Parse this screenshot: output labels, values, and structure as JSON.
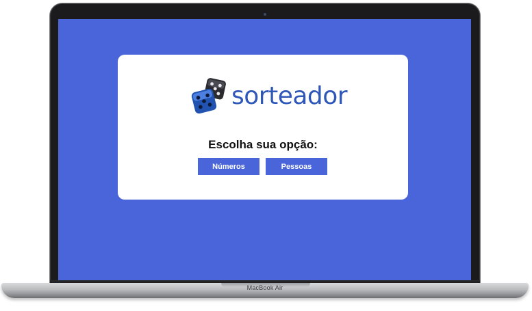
{
  "device": {
    "brand_label": "MacBook Air"
  },
  "app": {
    "logo_text": "sorteador",
    "prompt": "Escolha sua opção:",
    "buttons": {
      "numeros": "Números",
      "pessoas": "Pessoas"
    }
  },
  "colors": {
    "background": "#4a64d9",
    "card": "#ffffff",
    "button": "#4a64d9",
    "logo_text": "#2f57b8"
  },
  "icons": [
    "dice-icon"
  ]
}
